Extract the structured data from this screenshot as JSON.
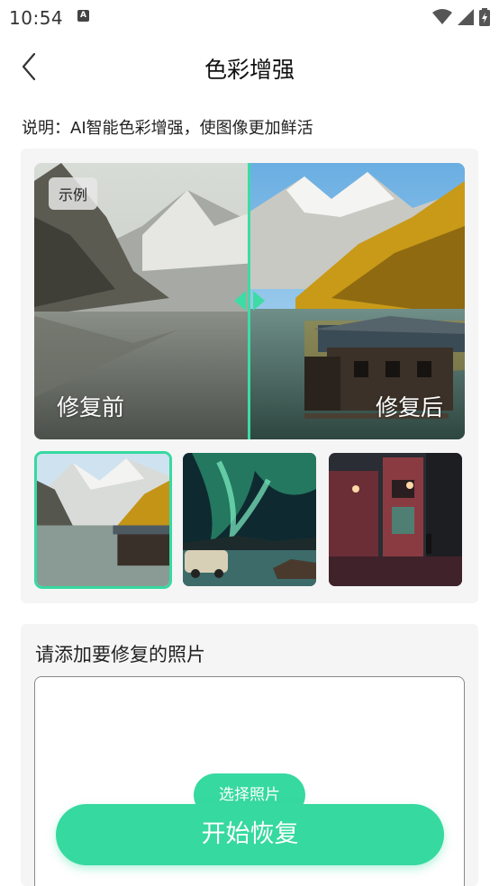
{
  "status_bar": {
    "time": "10:54",
    "icons": [
      "a-notification-icon",
      "wifi-icon",
      "signal-icon",
      "battery-icon"
    ]
  },
  "header": {
    "back_icon": "chevron-left-icon",
    "title": "色彩增强"
  },
  "description": "说明：AI智能色彩增强，使图像更加鲜活",
  "example": {
    "badge": "示例",
    "before_label": "修复前",
    "after_label": "修复后",
    "slider_position": 0.5,
    "thumbnails": [
      {
        "name": "lake-mountain-thumbnail",
        "selected": true
      },
      {
        "name": "aurora-thumbnail",
        "selected": false
      },
      {
        "name": "night-street-thumbnail",
        "selected": false
      }
    ]
  },
  "upload": {
    "title": "请添加要修复的照片",
    "select_button": "选择照片"
  },
  "start_button": "开始恢复",
  "colors": {
    "accent": "#36d9a0",
    "card_bg": "#f5f5f5"
  }
}
